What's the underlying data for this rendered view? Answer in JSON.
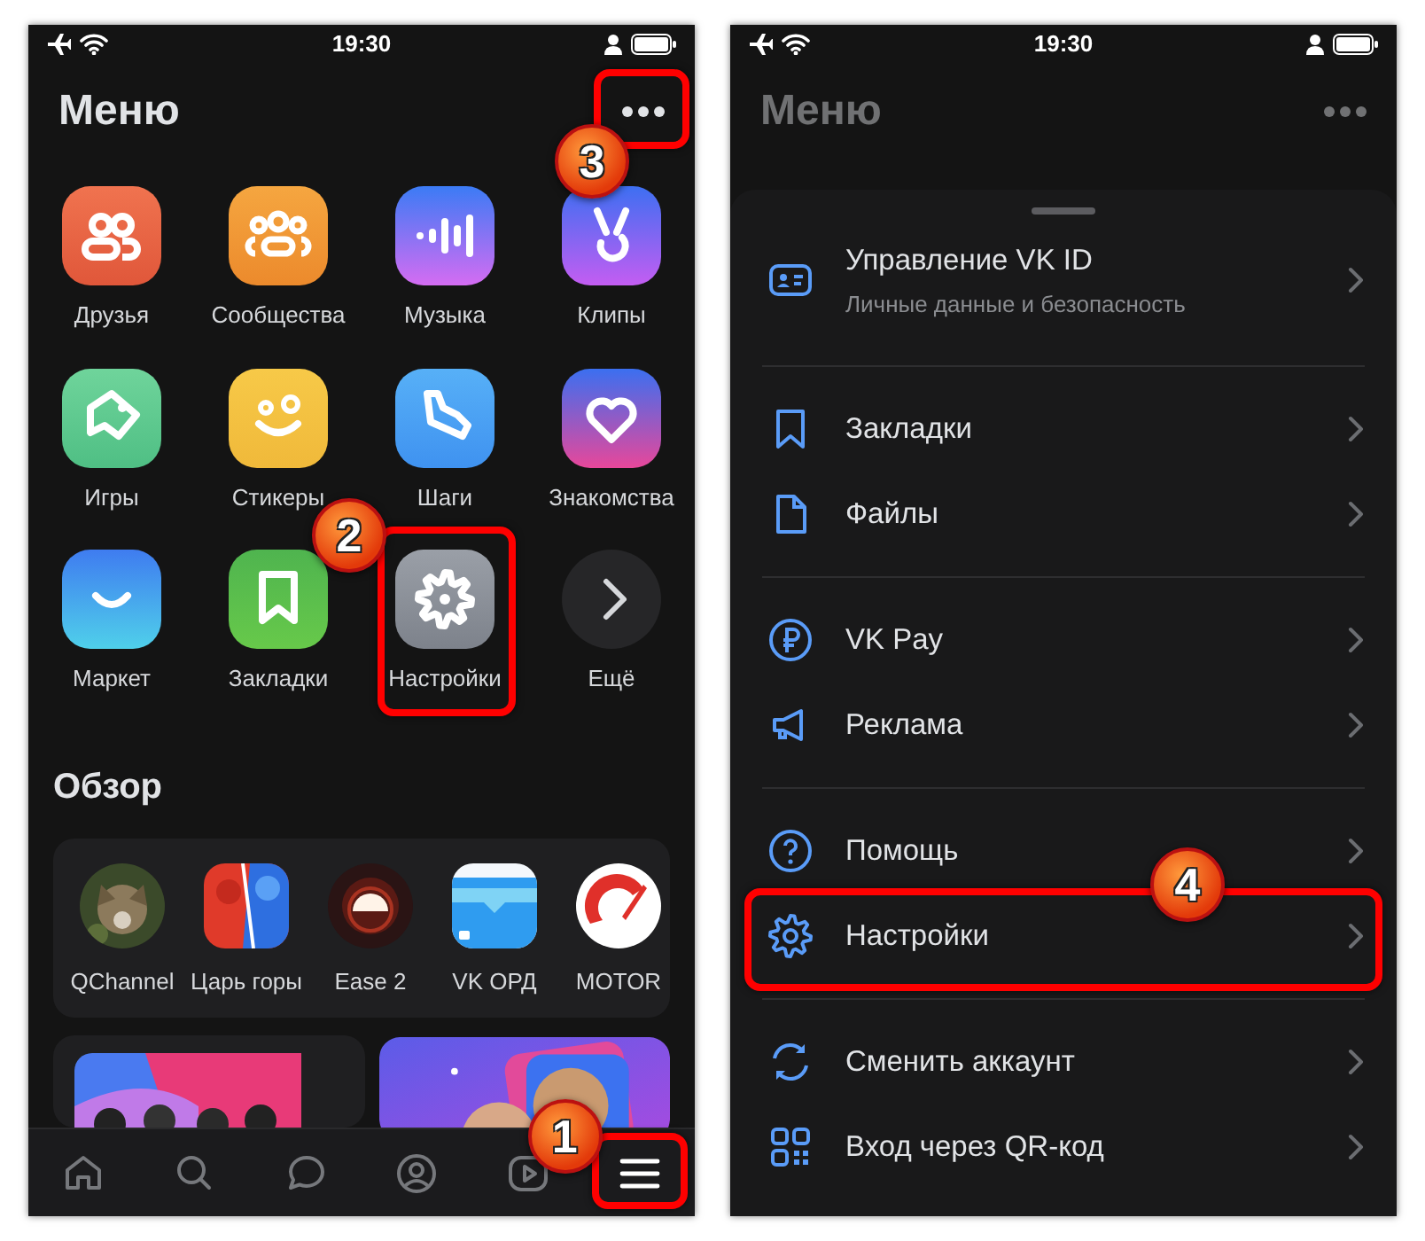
{
  "screens": [
    {
      "kind": "menu",
      "dimmed": false,
      "status_bar": {
        "time": "19:30"
      },
      "header": {
        "title": "Меню",
        "more_button": {
          "highlighted": true,
          "callout": "3"
        }
      },
      "apps": [
        {
          "label": "Друзья",
          "kind": "friends",
          "highlighted": false
        },
        {
          "label": "Сообщества",
          "kind": "communities",
          "highlighted": false
        },
        {
          "label": "Музыка",
          "kind": "music",
          "highlighted": false
        },
        {
          "label": "Клипы",
          "kind": "clips",
          "highlighted": false
        },
        {
          "label": "Игры",
          "kind": "games",
          "highlighted": false
        },
        {
          "label": "Стикеры",
          "kind": "stickers",
          "highlighted": false
        },
        {
          "label": "Шаги",
          "kind": "steps",
          "highlighted": false
        },
        {
          "label": "Знакомства",
          "kind": "dating",
          "highlighted": false
        },
        {
          "label": "Маркет",
          "kind": "market",
          "highlighted": false
        },
        {
          "label": "Закладки",
          "kind": "bookmarks",
          "highlighted": false
        },
        {
          "label": "Настройки",
          "kind": "settings",
          "highlighted": true,
          "callout": "2"
        },
        {
          "label": "Ещё",
          "kind": "more",
          "highlighted": false
        }
      ],
      "section_title": "Обзор",
      "mini_apps": [
        {
          "label": "QChannel"
        },
        {
          "label": "Царь горы"
        },
        {
          "label": "Ease 2"
        },
        {
          "label": "VK ОРД"
        },
        {
          "label": "MOTOR"
        }
      ],
      "promos": [
        {
          "kind": "picture"
        },
        {
          "kind": "picture"
        }
      ],
      "tab_bar": [
        {
          "kind": "home",
          "selected": false,
          "highlighted": false
        },
        {
          "kind": "search",
          "selected": false,
          "highlighted": false
        },
        {
          "kind": "messages",
          "selected": false,
          "highlighted": false
        },
        {
          "kind": "profile",
          "selected": false,
          "highlighted": false
        },
        {
          "kind": "video",
          "selected": false,
          "highlighted": false
        },
        {
          "kind": "menu",
          "selected": true,
          "highlighted": true,
          "callout": "1"
        }
      ]
    },
    {
      "kind": "sheet",
      "dimmed": true,
      "status_bar": {
        "time": "19:30"
      },
      "header": {
        "title": "Меню",
        "more_button": {
          "highlighted": false
        }
      },
      "sheet": {
        "groups": [
          [
            {
              "label": "Управление VK ID",
              "subtitle": "Личные данные и безопасность",
              "kind": "id-card",
              "highlighted": false
            }
          ],
          [
            {
              "label": "Закладки",
              "kind": "bookmark",
              "highlighted": false
            },
            {
              "label": "Файлы",
              "kind": "file",
              "highlighted": false
            }
          ],
          [
            {
              "label": "VK Pay",
              "kind": "ruble",
              "highlighted": false
            },
            {
              "label": "Реклама",
              "kind": "megaphone",
              "highlighted": false
            }
          ],
          [
            {
              "label": "Помощь",
              "kind": "help",
              "highlighted": false
            },
            {
              "label": "Настройки",
              "kind": "gear",
              "highlighted": true,
              "callout": "4"
            }
          ],
          [
            {
              "label": "Сменить аккаунт",
              "kind": "switch",
              "highlighted": false
            },
            {
              "label": "Вход через QR-код",
              "kind": "qr",
              "highlighted": false
            }
          ]
        ]
      }
    }
  ]
}
